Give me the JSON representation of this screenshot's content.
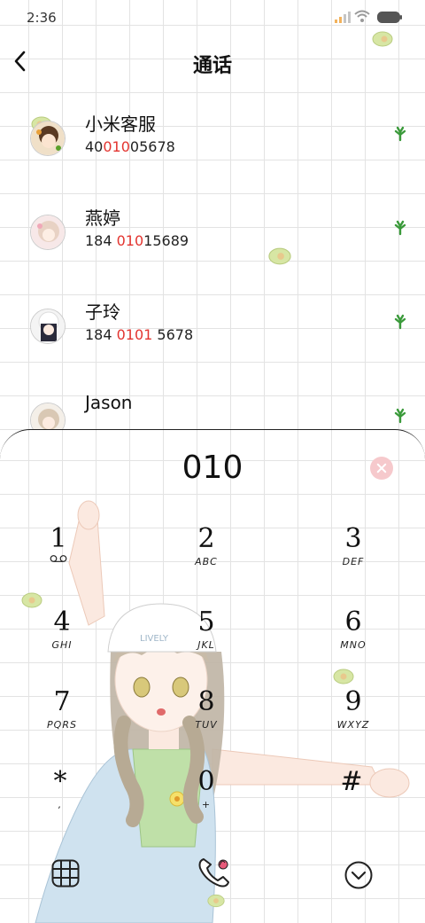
{
  "status_bar": {
    "time": "2:36"
  },
  "header": {
    "title": "通话"
  },
  "contacts": [
    {
      "name": "小米客服",
      "number_pre": "40",
      "number_hl": "010",
      "number_post": "05678"
    },
    {
      "name": "燕婷",
      "number_pre": "184 ",
      "number_hl": "010",
      "number_post": "15689"
    },
    {
      "name": "子玲",
      "number_pre": "184 ",
      "number_hl": "0101",
      "number_post": " 5678"
    },
    {
      "name": "Jason",
      "number_pre": "",
      "number_hl": "",
      "number_post": ""
    }
  ],
  "dialer": {
    "input": "010",
    "keys": [
      {
        "digit": "1",
        "letters": ""
      },
      {
        "digit": "2",
        "letters": "ABC"
      },
      {
        "digit": "3",
        "letters": "DEF"
      },
      {
        "digit": "4",
        "letters": "GHI"
      },
      {
        "digit": "5",
        "letters": "JKL"
      },
      {
        "digit": "6",
        "letters": "MNO"
      },
      {
        "digit": "7",
        "letters": "PQRS"
      },
      {
        "digit": "8",
        "letters": "TUV"
      },
      {
        "digit": "9",
        "letters": "WXYZ"
      },
      {
        "digit": "*",
        "letters": ","
      },
      {
        "digit": "0",
        "letters": "+"
      },
      {
        "digit": "#",
        "letters": ""
      }
    ],
    "cap_text": "LIVELY"
  },
  "colors": {
    "highlight": "#e3342f",
    "clear_button": "#f6c9cc",
    "leaf": "#3a9a3a",
    "avocado": "#d7e6a4"
  },
  "icons": {
    "back": "chevron-left-icon",
    "voicemail": "voicemail-icon",
    "keypad_toggle": "keypad-grid-icon",
    "call": "phone-call-icon",
    "collapse": "chevron-down-circle-icon"
  }
}
